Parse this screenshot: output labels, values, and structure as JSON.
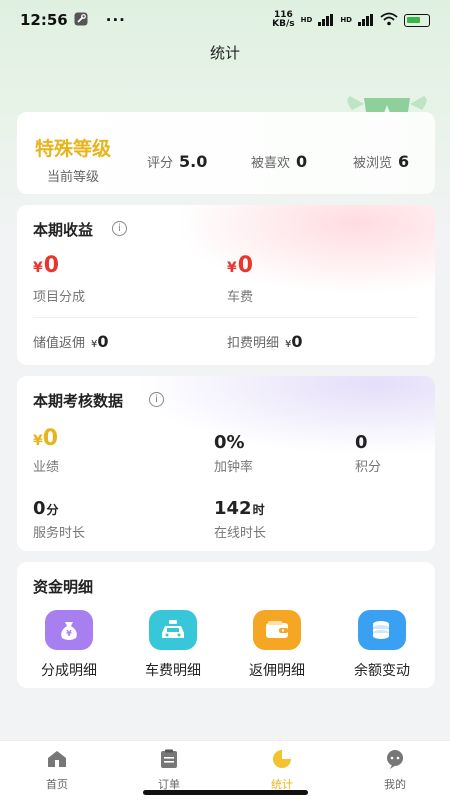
{
  "status_bar": {
    "time": "12:56",
    "more": "···",
    "net_speed_value": "116",
    "net_speed_unit": "KB/s",
    "net_type_1": "HD",
    "net_type_2": "HD"
  },
  "header": {
    "title": "统计"
  },
  "level": {
    "name": "特殊等级",
    "caption": "当前等级",
    "rating_label": "评分",
    "rating_value": "5.0",
    "likes_label": "被喜欢",
    "likes_value": "0",
    "views_label": "被浏览",
    "views_value": "6"
  },
  "income": {
    "title": "本期收益",
    "currency": "¥",
    "project_share_value": "0",
    "project_share_label": "项目分成",
    "car_fee_value": "0",
    "car_fee_label": "车费",
    "stored_rebate_label": "储值返佣",
    "stored_rebate_value": "0",
    "deduction_label": "扣费明细",
    "deduction_value": "0"
  },
  "assessment": {
    "title": "本期考核数据",
    "currency": "¥",
    "performance_value": "0",
    "performance_label": "业绩",
    "overtime_rate_value": "0%",
    "overtime_rate_label": "加钟率",
    "points_value": "0",
    "points_label": "积分",
    "service_time_value": "0",
    "service_time_unit": "分",
    "service_time_label": "服务时长",
    "online_time_value": "142",
    "online_time_unit": "时",
    "online_time_label": "在线时长"
  },
  "funds": {
    "title": "资金明细",
    "items": [
      {
        "label": "分成明细",
        "icon": "money-bag-icon",
        "color": "#a77ff0"
      },
      {
        "label": "车费明细",
        "icon": "taxi-icon",
        "color": "#38c6d9"
      },
      {
        "label": "返佣明细",
        "icon": "wallet-icon",
        "color": "#f5a623"
      },
      {
        "label": "余额变动",
        "icon": "coins-icon",
        "color": "#3aa0f2"
      }
    ]
  },
  "tabbar": {
    "items": [
      {
        "label": "首页"
      },
      {
        "label": "订单"
      },
      {
        "label": "统计"
      },
      {
        "label": "我的"
      }
    ],
    "active_color": "#e6b51e"
  }
}
